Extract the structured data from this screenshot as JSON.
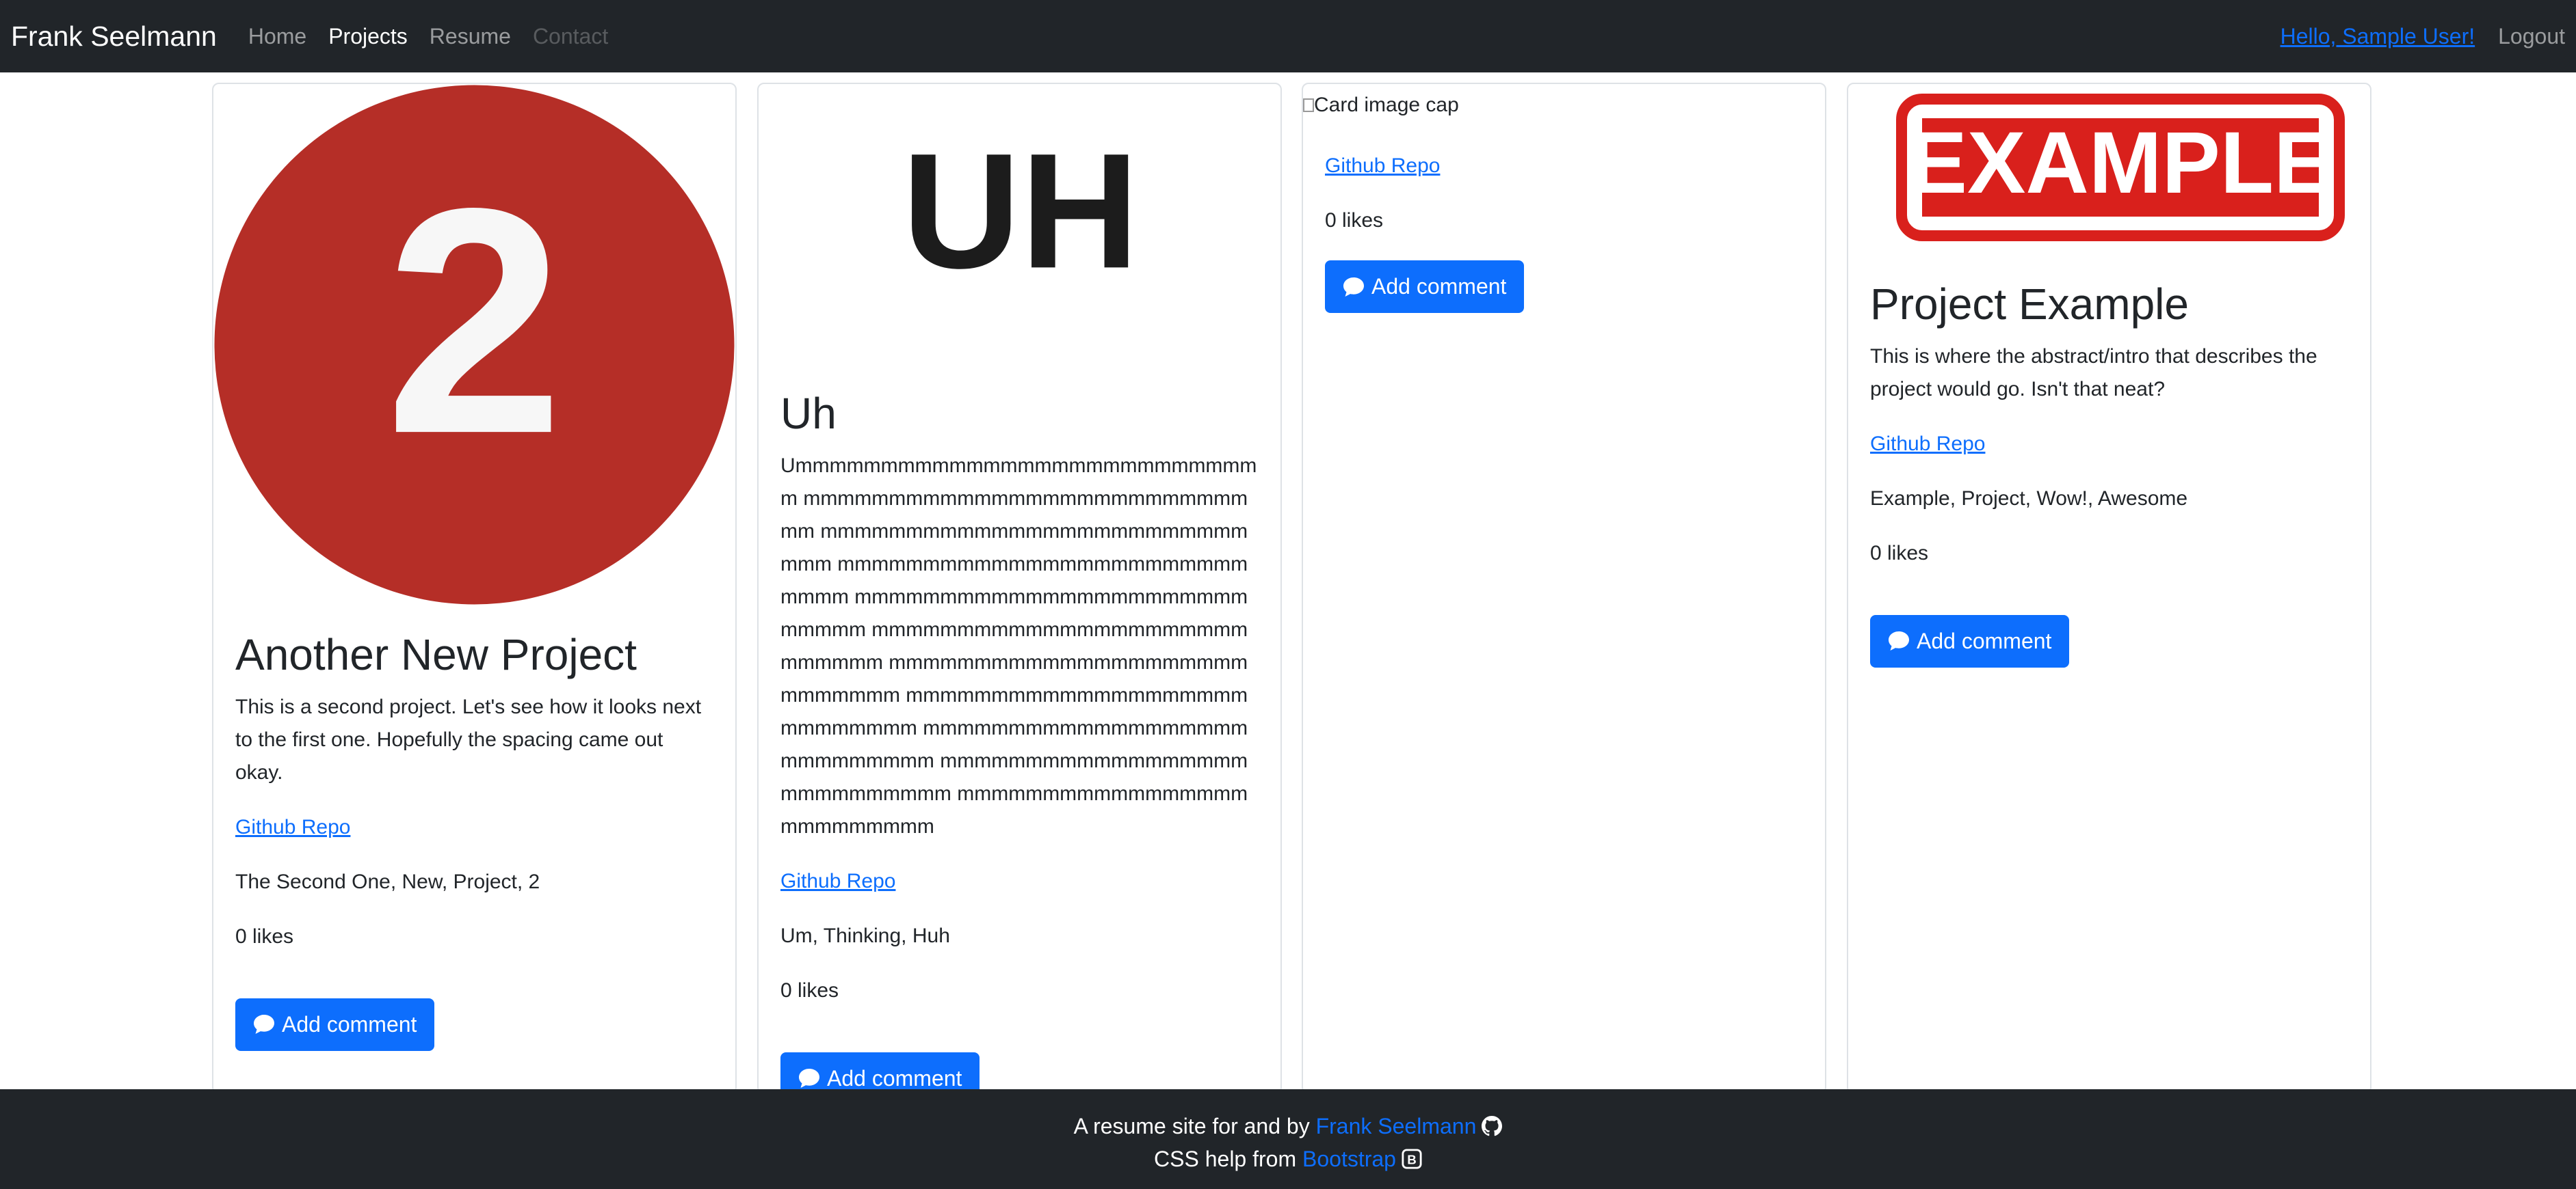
{
  "navbar": {
    "brand": "Frank Seelmann",
    "links": [
      "Home",
      "Projects",
      "Resume",
      "Contact"
    ],
    "user_link": "Hello, Sample User!",
    "logout": "Logout"
  },
  "cards": [
    {
      "image_text": "2",
      "title": "Another New Project",
      "abstract": "This is a second project. Let's see how it looks next to the first one. Hopefully the spacing came out okay.",
      "repo_link": "Github Repo",
      "tags": "The Second One, New, Project, 2",
      "likes": "0 likes",
      "comment_button": "Add comment"
    },
    {
      "image_text": "UH",
      "title": "Uh",
      "abstract": "Ummmmmmmmmmmmmmmmmmmmmmmmmmmm mmmmmmmmmmmmmmmmmmmmmmmmmmmm mmmmmmmmmmmmmmmmmmmmmmmmmmmm mmmmmmmmmmmmmmmmmmmmmmmmmmmm mmmmmmmmmmmmmmmmmmmmmmmmmmmm mmmmmmmmmmmmmmmmmmmmmmmmmmmm mmmmmmmmmmmmmmmmmmmmmmmmmmmm mmmmmmmmmmmmmmmmmmmmmmmmmmmm mmmmmmmmmmmmmmmmmmmmmmmmmmmm mmmmmmmmmmmmmmmmmmmmmmmmmmmm mmmmmmmmmmmmmmmmmmmmmmmmmm",
      "repo_link": "Github Repo",
      "tags": "Um, Thinking, Huh",
      "likes": "0 likes",
      "comment_button": "Add comment"
    },
    {
      "image_alt": "Card image cap",
      "repo_link": "Github Repo",
      "likes": "0 likes",
      "comment_button": "Add comment"
    },
    {
      "image_text": "EXAMPLE",
      "title": "Project Example",
      "abstract": "This is where the abstract/intro that describes the project would go. Isn't that neat?",
      "repo_link": "Github Repo",
      "tags": "Example, Project, Wow!, Awesome",
      "likes": "0 likes",
      "comment_button": "Add comment"
    }
  ],
  "footer": {
    "line1_prefix": "A resume site for and by",
    "line1_link": "Frank Seelmann",
    "line2_prefix": "CSS help from",
    "line2_link": "Bootstrap"
  },
  "colors": {
    "navbar_bg": "#212529",
    "primary": "#0d6efd",
    "badge_red": "#b52e27",
    "stamp_red": "#d9201c"
  },
  "icons": [
    "chat-icon",
    "github-icon",
    "bootstrap-icon"
  ]
}
